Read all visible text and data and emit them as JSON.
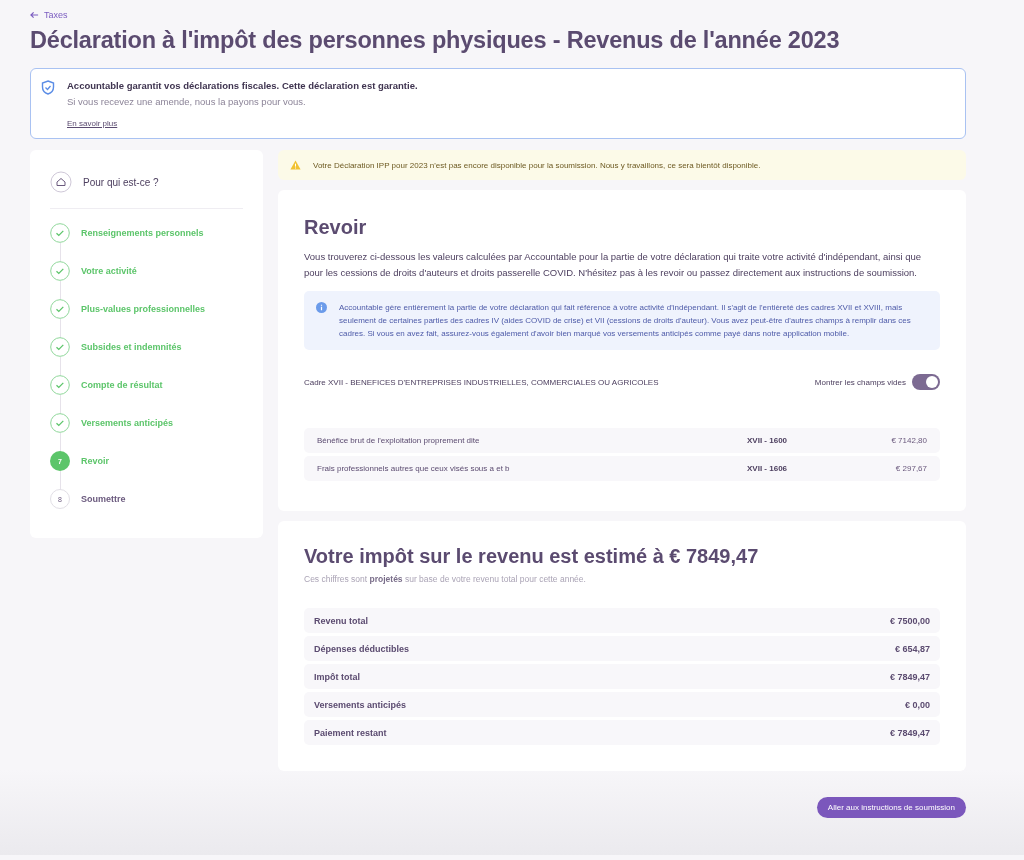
{
  "back_link": "Taxes",
  "title": "Déclaration à l'impôt des personnes physiques - Revenus de l'année 2023",
  "guarantee": {
    "heading": "Accountable garantit vos déclarations fiscales. Cette déclaration est garantie.",
    "text": "Si vous recevez une amende, nous la payons pour vous.",
    "link": "En savoir plus"
  },
  "steps": [
    {
      "kind": "home",
      "label": "Pour qui est-ce ?"
    },
    {
      "kind": "step",
      "label": "Renseignements personnels",
      "completed": true,
      "selected": false
    },
    {
      "kind": "step",
      "label": "Votre activité",
      "completed": true,
      "selected": false
    },
    {
      "kind": "step",
      "label": "Plus-values professionnelles",
      "completed": true,
      "selected": false
    },
    {
      "kind": "step",
      "label": "Subsides et indemnités",
      "completed": true,
      "selected": false
    },
    {
      "kind": "step",
      "label": "Compte de résultat",
      "completed": true,
      "selected": false
    },
    {
      "kind": "step",
      "label": "Versements anticipés",
      "completed": true,
      "selected": false
    },
    {
      "kind": "step",
      "label": "Revoir",
      "number": "7",
      "completed": false,
      "selected": true
    },
    {
      "kind": "step",
      "label": "Soumettre",
      "number": "8",
      "completed": false,
      "selected": false
    }
  ],
  "warning": "Votre Déclaration IPP pour 2023 n'est pas encore disponible pour la soumission. Nous y travaillons, ce sera bientôt disponible.",
  "review": {
    "heading": "Revoir",
    "intro": "Vous trouverez ci-dessous les valeurs calculées par Accountable pour la partie de votre déclaration qui traite votre activité d'indépendant, ainsi que pour les cessions de droits d'auteurs et droits passerelle COVID. N'hésitez pas à les revoir ou passez directement aux instructions de soumission.",
    "info": "Accountable gère entièrement la partie de votre déclaration qui fait référence à votre activité d'indépendant. Il s'agit de l'entièreté des cadres XVII et XVIII, mais seulement de certaines parties des cadres IV (aides COVID de crise) et VII (cessions de droits d'auteur). Vous avez peut-être d'autres champs à remplir dans ces cadres. Si vous en avez fait, assurez-vous également d'avoir bien marqué vos versements anticipés comme payé dans notre application mobile.",
    "section": "Cadre XVII - BENEFICES D'ENTREPRISES INDUSTRIELLES, COMMERCIALES OU AGRICOLES",
    "toggle": {
      "label": "Montrer les champs vides",
      "on": true
    },
    "rows": [
      {
        "label": "Bénéfice brut de l'exploitation proprement dite",
        "code": "XVII - 1600",
        "amount": "€ 7142,80"
      },
      {
        "label": "Frais professionnels autres que ceux visés sous a et b",
        "code": "XVII - 1606",
        "amount": "€ 297,67"
      }
    ]
  },
  "estimate": {
    "heading": "Votre impôt sur le revenu est estimé à € 7849,47",
    "subtitle": "Ces chiffres sont **projetés** sur base de votre revenu total pour cette année.",
    "rows": [
      {
        "label": "Revenu total",
        "amount": "€ 7500,00"
      },
      {
        "label": "Dépenses déductibles",
        "amount": "€ 654,87"
      },
      {
        "label": "Impôt total",
        "amount": "€ 7849,47"
      },
      {
        "label": "Versements anticipés",
        "amount": "€ 0,00"
      },
      {
        "label": "Paiement restant",
        "amount": "€ 7849,47"
      }
    ]
  },
  "submit_button": "Aller aux instructions de soumission"
}
